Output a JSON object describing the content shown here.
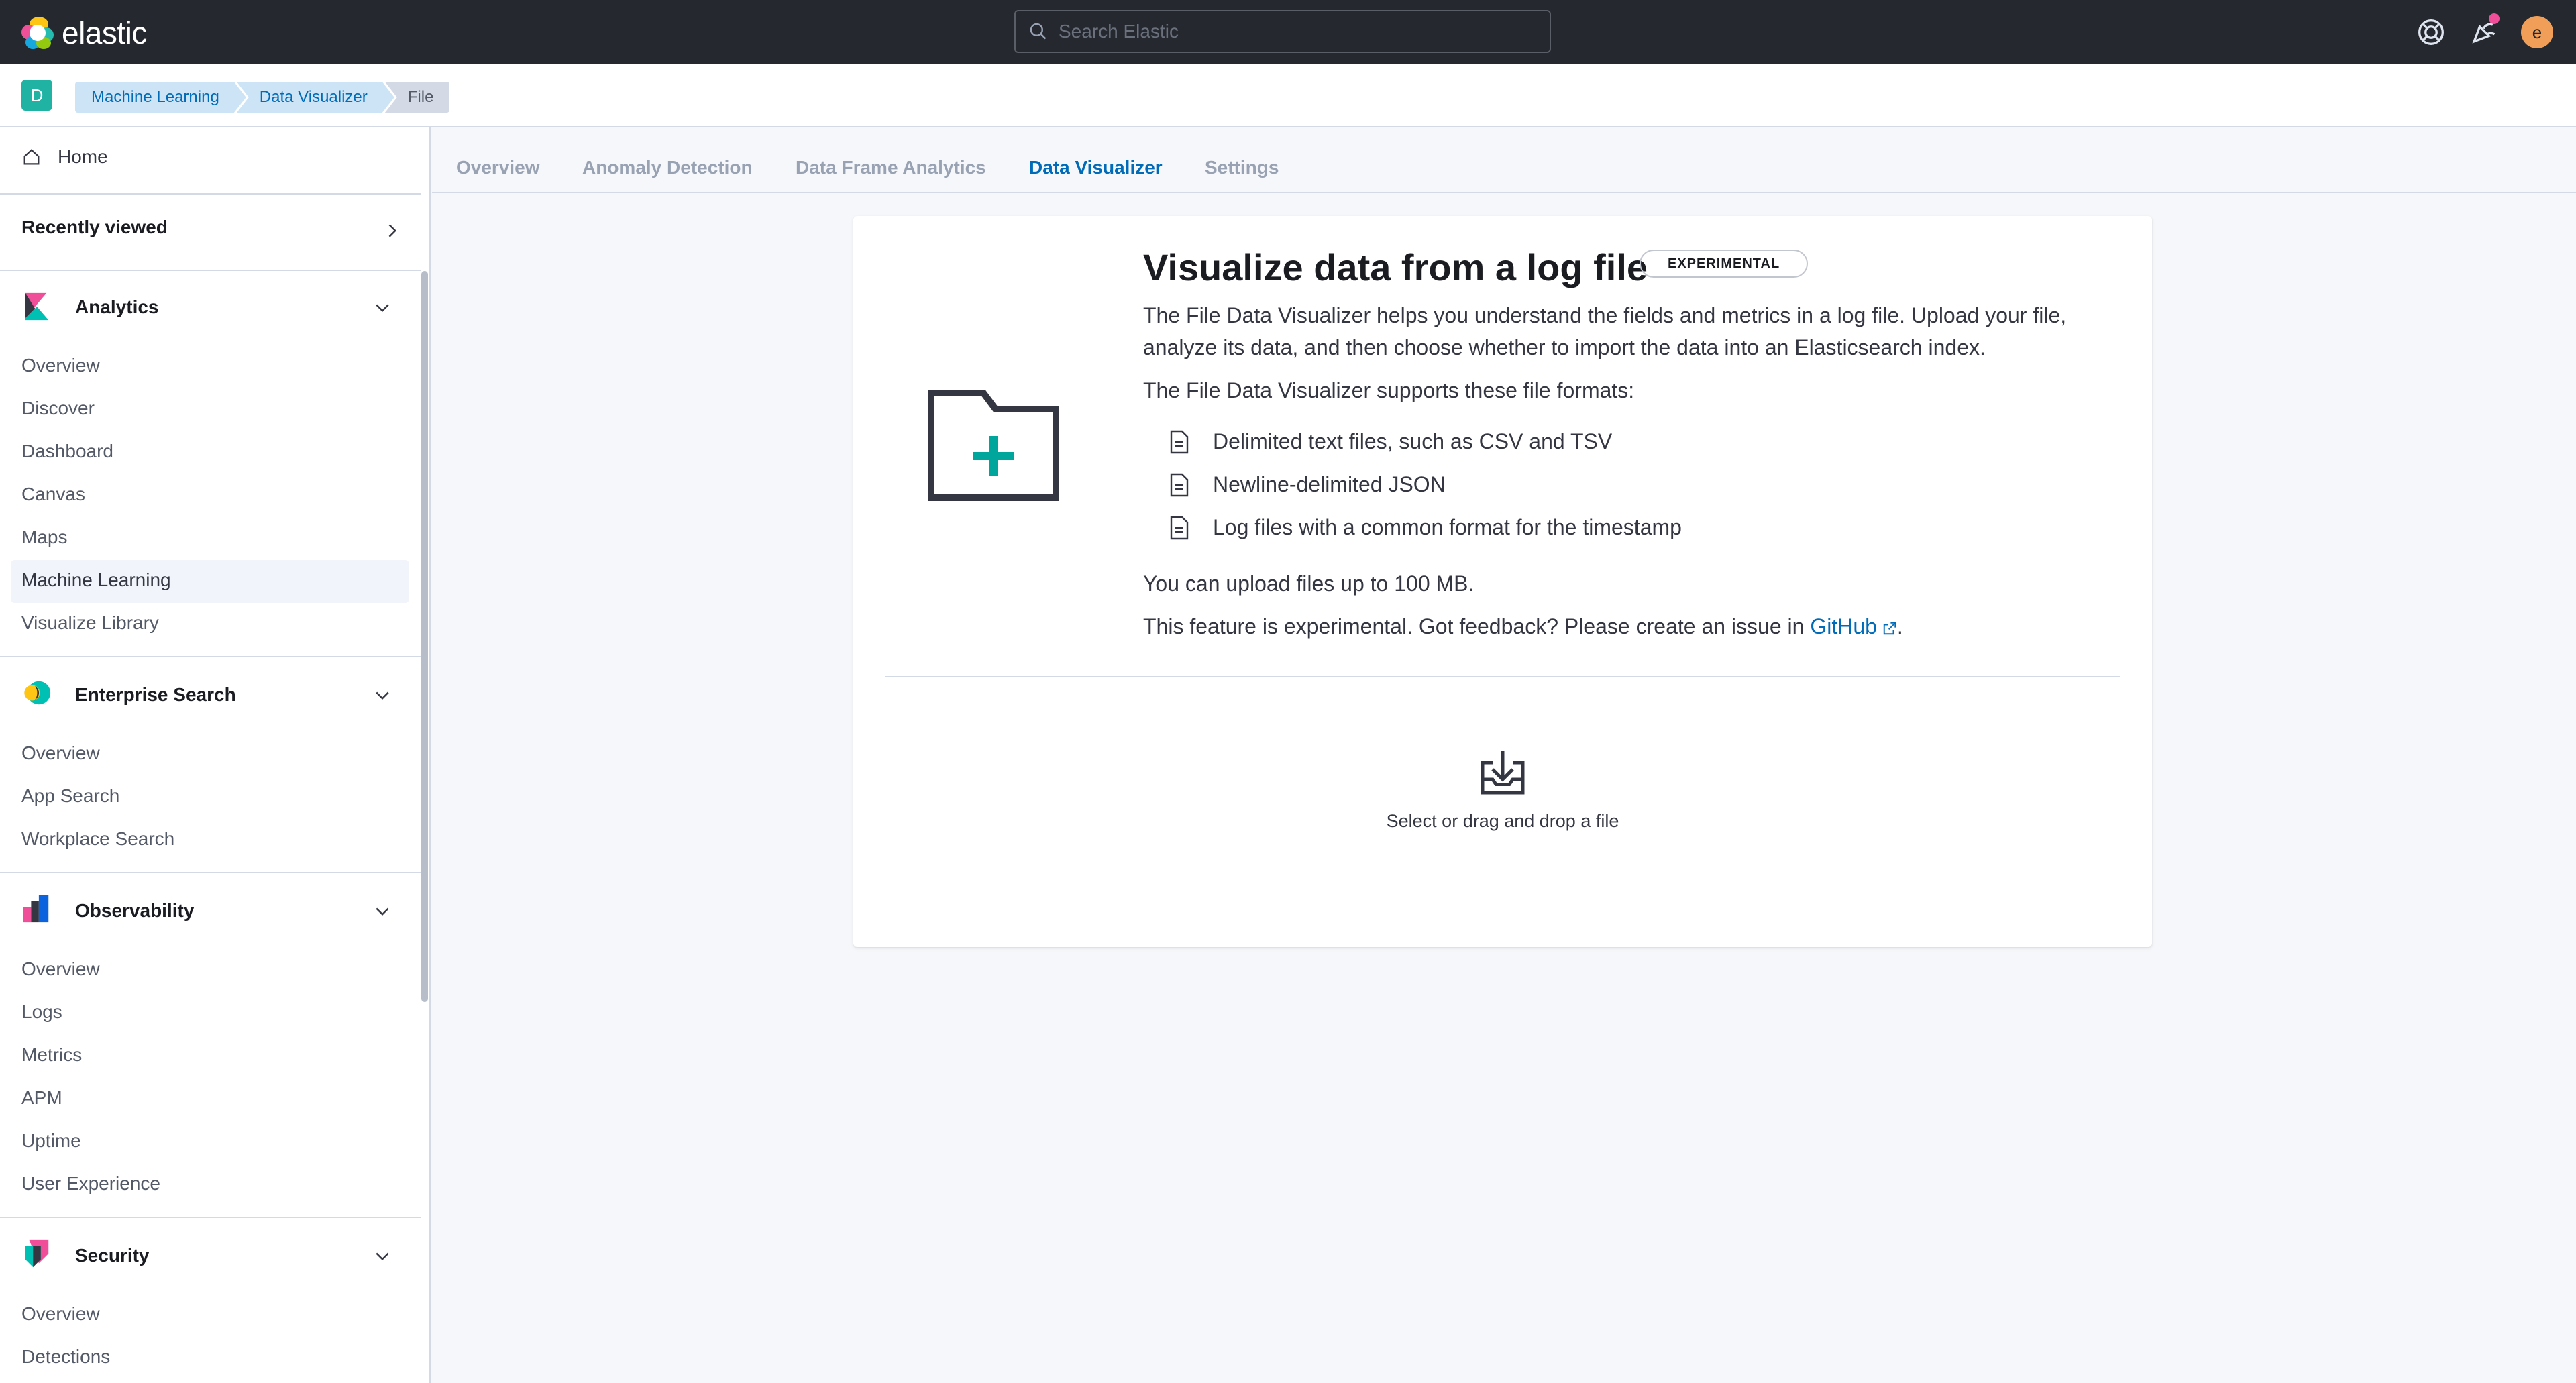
{
  "header": {
    "logo_text": "elastic",
    "search_placeholder": "Search Elastic",
    "icons": [
      "help-icon",
      "news-icon",
      "user-avatar"
    ],
    "avatar_letter": "e",
    "avatar_color": "#f19f58",
    "notification_dot_color": "#f04e98"
  },
  "breadcrumb": {
    "space_letter": "D",
    "space_color": "#20b3a4",
    "items": [
      "Machine Learning",
      "Data Visualizer",
      "File"
    ]
  },
  "sidenav": {
    "home": "Home",
    "recently_viewed": "Recently viewed",
    "groups": [
      {
        "title": "Analytics",
        "icon": "kibana-icon",
        "items": [
          "Overview",
          "Discover",
          "Dashboard",
          "Canvas",
          "Maps",
          "Machine Learning",
          "Visualize Library"
        ],
        "active": "Machine Learning"
      },
      {
        "title": "Enterprise Search",
        "icon": "enterprise-search-icon",
        "items": [
          "Overview",
          "App Search",
          "Workplace Search"
        ]
      },
      {
        "title": "Observability",
        "icon": "observability-icon",
        "items": [
          "Overview",
          "Logs",
          "Metrics",
          "APM",
          "Uptime",
          "User Experience"
        ]
      },
      {
        "title": "Security",
        "icon": "security-icon",
        "items": [
          "Overview",
          "Detections"
        ]
      }
    ]
  },
  "tabs": {
    "items": [
      "Overview",
      "Anomaly Detection",
      "Data Frame Analytics",
      "Data Visualizer",
      "Settings"
    ],
    "active": "Data Visualizer",
    "active_color": "#006bb8"
  },
  "card": {
    "title": "Visualize data from a log file",
    "badge": "EXPERIMENTAL",
    "intro_line1": "The File Data Visualizer helps you understand the fields and metrics in a log file. Upload your file,",
    "intro_line2": "analyze its data, and then choose whether to import the data into an Elasticsearch index.",
    "formats_intro": "The File Data Visualizer supports these file formats:",
    "formats": [
      "Delimited text files, such as CSV and TSV",
      "Newline-delimited JSON",
      "Log files with a common format for the timestamp"
    ],
    "limit_text": "You can upload files up to 100 MB.",
    "feedback_text": "This feature is experimental. Got feedback? Please create an issue in",
    "feedback_link": "GitHub",
    "feedback_end": ".",
    "upload_text": "Select or drag and drop a file",
    "accent_color": "#00a69b"
  }
}
